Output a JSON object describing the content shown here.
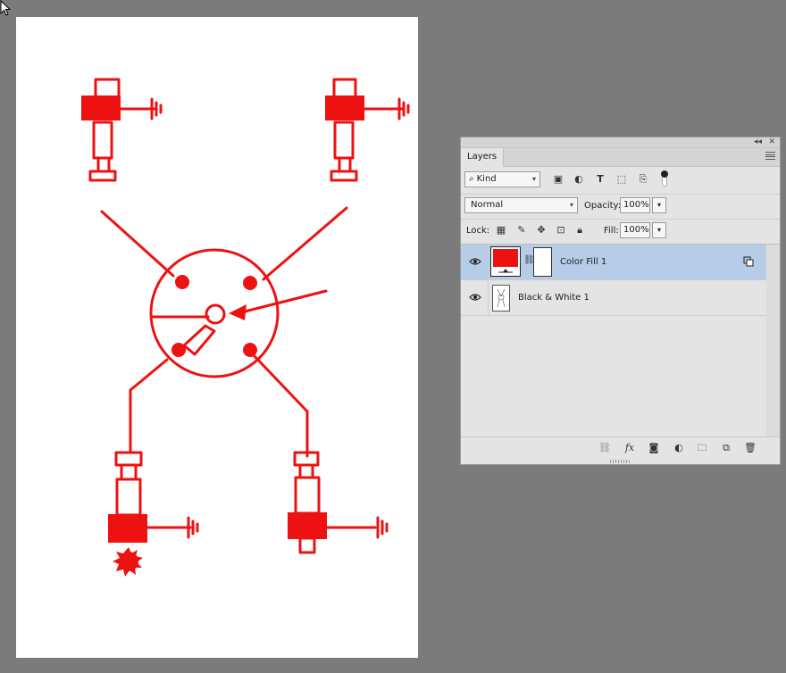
{
  "panel": {
    "tab_label": "Layers",
    "filter": {
      "kind_label": "Kind"
    },
    "blend_mode": "Normal",
    "opacity_label": "Opacity:",
    "opacity_value": "100%",
    "lock_label": "Lock:",
    "fill_label": "Fill:",
    "fill_value": "100%",
    "layers": [
      {
        "name": "Color Fill 1",
        "selected": true,
        "visible": true,
        "fill_color": "#ee1111"
      },
      {
        "name": "Black & White 1",
        "selected": false,
        "visible": true
      }
    ]
  },
  "colors": {
    "workspace": "#7b7b7b",
    "drawing_red": "#ee1111",
    "selection": "#b7cce6"
  }
}
